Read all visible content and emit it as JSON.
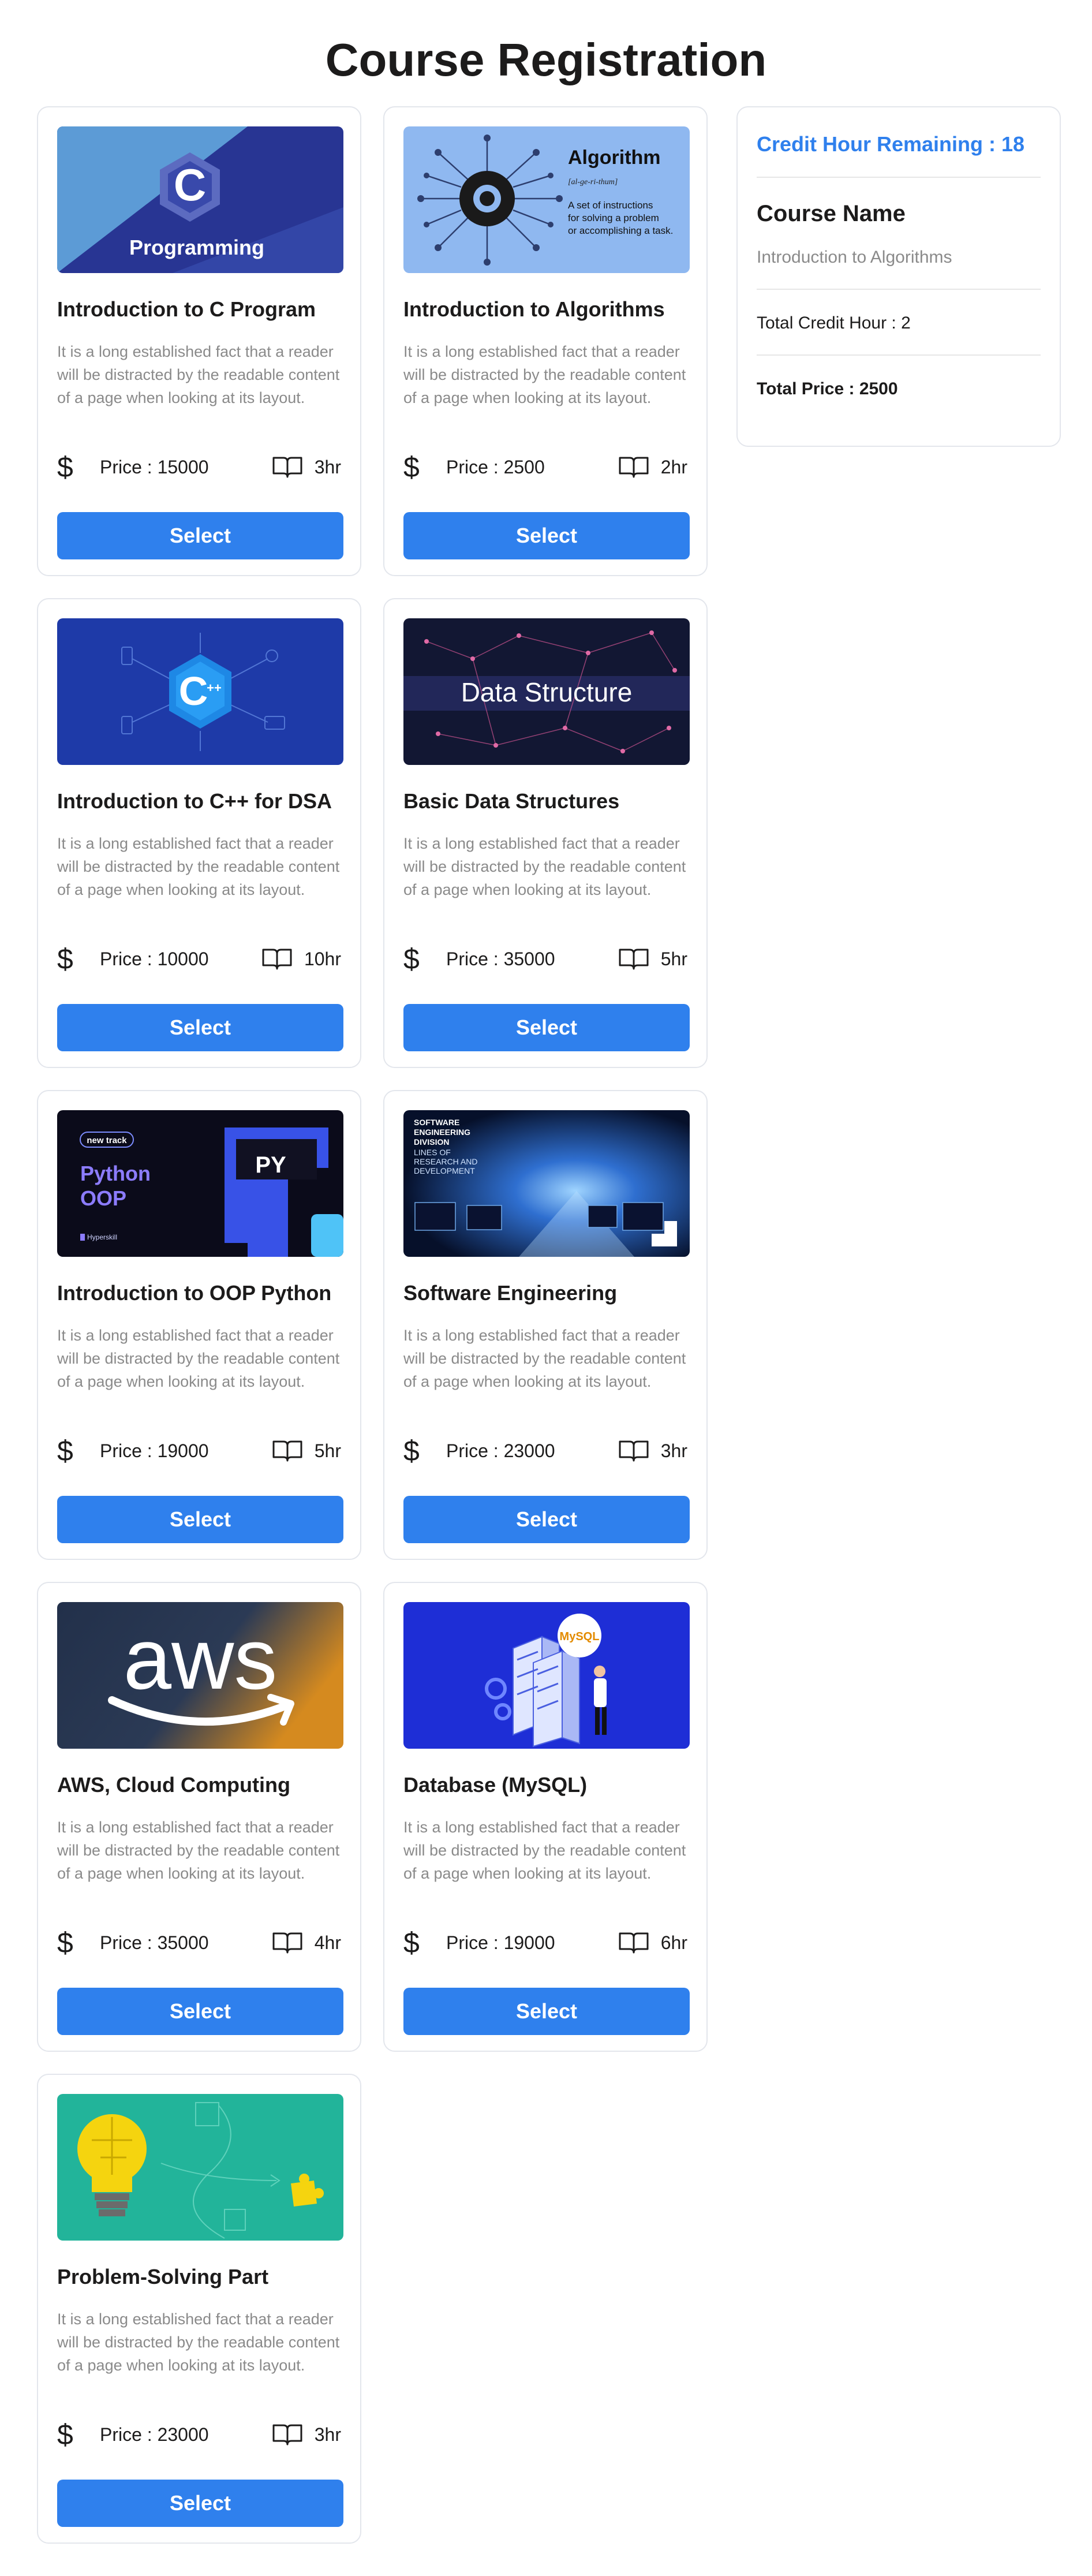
{
  "header": {
    "title": "Course Registration"
  },
  "common": {
    "description": "It is a long established fact that a reader will be distracted by the readable content of a page when looking at its layout.",
    "price_prefix": "Price : ",
    "select_label": "Select",
    "currency_symbol": "$",
    "accent_color": "#2f80ed"
  },
  "courses": [
    {
      "title": "Introduction to C Program",
      "price": "15000",
      "hours": "3hr",
      "thumb_text": "Programming",
      "thumb_icon": "c-logo-icon"
    },
    {
      "title": "Introduction to Algorithms",
      "price": "2500",
      "hours": "2hr",
      "thumb_text": "Algorithm",
      "thumb_sub": "[al-ge-ri-thum]",
      "thumb_note": "A set of instructions for solving a problem or accomplishing a task.",
      "thumb_icon": "circuit-gear-icon"
    },
    {
      "title": "Introduction to C++ for DSA",
      "price": "10000",
      "hours": "10hr",
      "thumb_text": "C++",
      "thumb_icon": "cpp-logo-icon"
    },
    {
      "title": "Basic Data Structures",
      "price": "35000",
      "hours": "5hr",
      "thumb_text": "Data Structure",
      "thumb_icon": "network-icon"
    },
    {
      "title": "Introduction to OOP Python",
      "price": "19000",
      "hours": "5hr",
      "thumb_text": "Python OOP",
      "thumb_badge": "new track",
      "thumb_mark": "PY",
      "thumb_brand": "Hyperskill",
      "thumb_icon": "python-icon"
    },
    {
      "title": "Software Engineering",
      "price": "23000",
      "hours": "3hr",
      "thumb_text": "SOFTWARE ENGINEERING DIVISION",
      "thumb_sub": "LINES OF RESEARCH AND DEVELOPMENT",
      "thumb_icon": "monitors-icon"
    },
    {
      "title": "AWS, Cloud Computing",
      "price": "35000",
      "hours": "4hr",
      "thumb_text": "aws",
      "thumb_icon": "aws-logo-icon"
    },
    {
      "title": "Database (MySQL)",
      "price": "19000",
      "hours": "6hr",
      "thumb_text": "MySQL",
      "thumb_icon": "server-icon"
    },
    {
      "title": "Problem-Solving Part",
      "price": "23000",
      "hours": "3hr",
      "thumb_icon": "lightbulb-puzzle-icon"
    }
  ],
  "cart": {
    "credit_remaining": "Credit Hour Remaining : 18",
    "course_name_heading": "Course Name",
    "items": [
      "Introduction to Algorithms"
    ],
    "total_credit": "Total Credit Hour : 2",
    "total_price": "Total Price : 2500"
  }
}
